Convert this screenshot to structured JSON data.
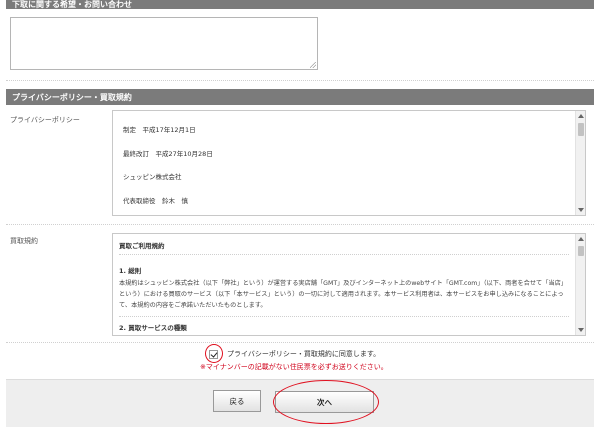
{
  "sections": {
    "inquiry_title": "下取に関する希望・お問い合わせ",
    "policy_title": "プライバシーポリシー・買取規約"
  },
  "privacy": {
    "label": "プライバシーポリシー",
    "lines": [
      "制定　平成17年12月1日",
      "最終改訂　平成27年10月28日",
      "シュッピン株式会社",
      "代表取締役　鈴木　慎"
    ]
  },
  "terms": {
    "label": "買取規約",
    "heading": "買取ご利用規約",
    "section1_title": "1. 総則",
    "section1_body": "本規約はシュッピン株式会社（以下「弊社」という）が運営する実店舗「GMT」及びインターネット上のwebサイト「GMT.com」（以下、両者を合せて「当店」という）における買取のサービス（以下「本サービス」という）の一切に対して適用されます。本サービス利用者は、本サービスをお申し込みになることによって、本規約の内容をご承諾いただいたものとします。",
    "section2_title": "2. 買取サービスの種類"
  },
  "consent": {
    "label": "プライバシーポリシー・買取規約に同意します。",
    "checked": true,
    "note": "※マイナンバーの記載がない住民票を必ずお送りください。"
  },
  "buttons": {
    "back": "戻る",
    "next": "次へ"
  },
  "colors": {
    "section_bar": "#7b7b7b",
    "note_red": "#d0021b",
    "annotation_red": "#e0101f"
  }
}
